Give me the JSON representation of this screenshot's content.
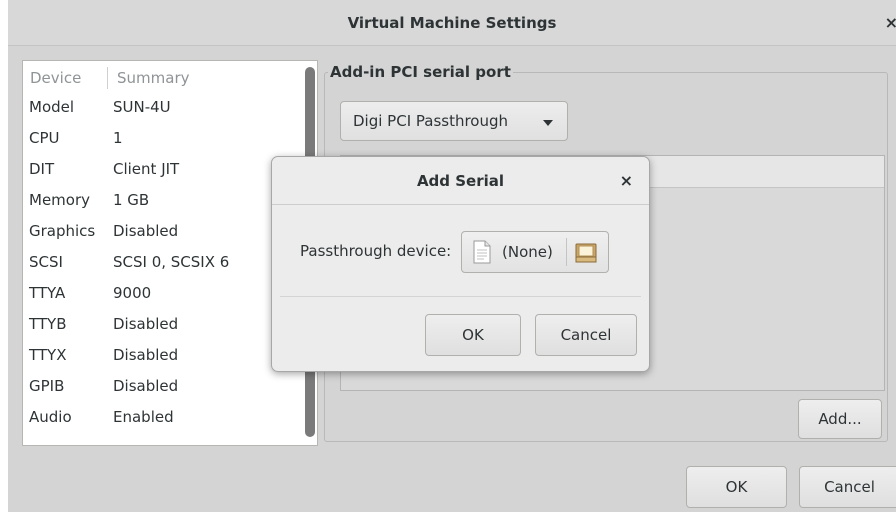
{
  "window": {
    "title": "Virtual Machine Settings",
    "close_glyph": "×"
  },
  "device_list": {
    "headers": {
      "device": "Device",
      "summary": "Summary"
    },
    "rows": [
      {
        "device": "Model",
        "summary": "SUN-4U"
      },
      {
        "device": "CPU",
        "summary": "1"
      },
      {
        "device": "DIT",
        "summary": "Client JIT"
      },
      {
        "device": "Memory",
        "summary": "1 GB"
      },
      {
        "device": "Graphics",
        "summary": "Disabled"
      },
      {
        "device": "SCSI",
        "summary": "SCSI 0, SCSIX 6"
      },
      {
        "device": "TTYA",
        "summary": "9000"
      },
      {
        "device": "TTYB",
        "summary": "Disabled"
      },
      {
        "device": "TTYX",
        "summary": "Disabled"
      },
      {
        "device": "GPIB",
        "summary": "Disabled"
      },
      {
        "device": "Audio",
        "summary": "Enabled"
      }
    ]
  },
  "serial_panel": {
    "group_label": "Add-in PCI serial port",
    "type_combo": {
      "selected": "Digi PCI Passthrough",
      "icon": "chevron-down-icon"
    },
    "add_button": "Add..."
  },
  "footer": {
    "ok_label": "OK",
    "cancel_label": "Cancel"
  },
  "dialog": {
    "title": "Add Serial",
    "close_glyph": "×",
    "passthrough_label": "Passthrough device:",
    "device_chooser": {
      "value": "(None)",
      "file_icon": "document-icon",
      "browse_icon": "folder-icon"
    },
    "ok_label": "OK",
    "cancel_label": "Cancel"
  }
}
